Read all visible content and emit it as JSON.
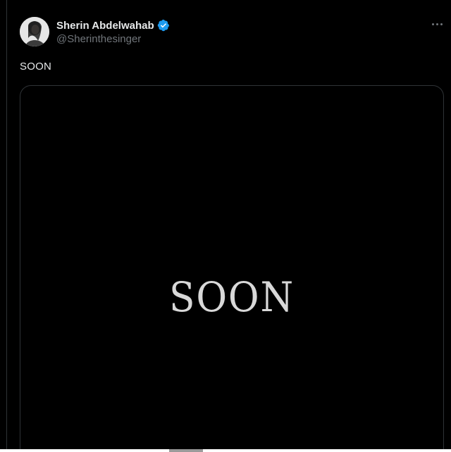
{
  "author": {
    "display_name": "Sherin Abdelwahab",
    "handle": "@Sherinthesinger",
    "verified_color": "#1d9bf0"
  },
  "tweet": {
    "text": "SOON"
  },
  "media": {
    "text": "SOON",
    "background": "#000000"
  },
  "icons": {
    "more": "more-horizontal-icon",
    "verified": "verified-badge-icon",
    "avatar": "avatar"
  }
}
